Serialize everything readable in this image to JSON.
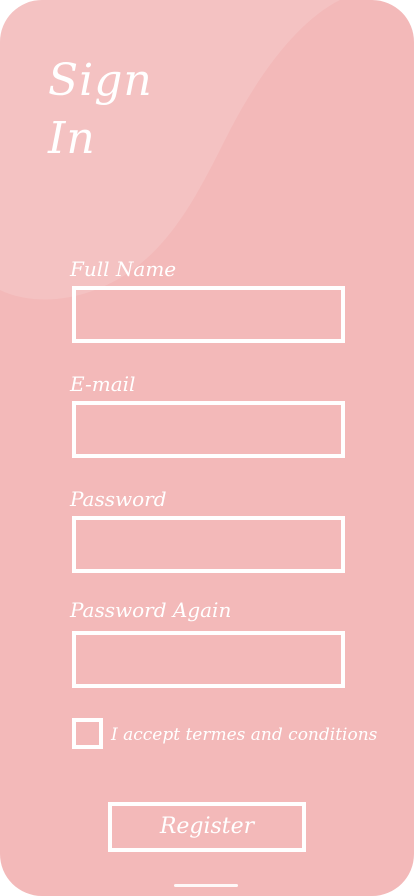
{
  "header": {
    "title_line1": "Sign",
    "title_line2": "In"
  },
  "form": {
    "full_name": {
      "label": "Full Name",
      "value": ""
    },
    "email": {
      "label": "E-mail",
      "value": ""
    },
    "password": {
      "label": "Password",
      "value": ""
    },
    "password_again": {
      "label": "Password Again",
      "value": ""
    },
    "terms": {
      "label": "I accept termes and conditions",
      "checked": false
    },
    "register_label": "Register"
  },
  "colors": {
    "background": "#f3b9b9",
    "accent": "#ffffff"
  }
}
